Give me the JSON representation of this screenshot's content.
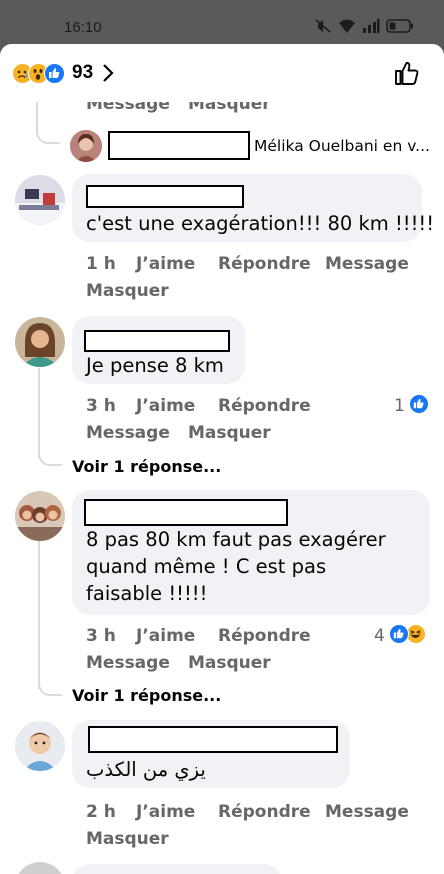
{
  "status_bar": {
    "time": "16:10"
  },
  "header": {
    "reaction_count": "93"
  },
  "partial_top": {
    "message": "Message",
    "hide": "Masquer"
  },
  "reply_preview": {
    "text": "Mélika Ouelbani en v..."
  },
  "comments": [
    {
      "text": "c'est une exagération!!! 80 km !!!!!",
      "time": "1 h",
      "like": "J’aime",
      "reply": "Répondre",
      "message": "Message",
      "hide": "Masquer"
    },
    {
      "text": "Je pense 8 km",
      "time": "3 h",
      "like": "J’aime",
      "reply": "Répondre",
      "message": "Message",
      "hide": "Masquer",
      "reaction_count": "1",
      "view_replies": "Voir 1 réponse..."
    },
    {
      "text_lines": [
        "8 pas 80 km faut pas exagérer",
        "quand même ! C est pas",
        "faisable !!!!!"
      ],
      "time": "3 h",
      "like": "J’aime",
      "reply": "Répondre",
      "message": "Message",
      "hide": "Masquer",
      "reaction_count": "4",
      "view_replies": "Voir 1 réponse..."
    },
    {
      "text": "يزي من الكذب",
      "time": "2 h",
      "like": "J’aime",
      "reply": "Répondre",
      "message": "Message",
      "hide": "Masquer"
    }
  ],
  "colors": {
    "accent": "#1877f2",
    "bubble": "#f0f2f5",
    "secondary_text": "#65676b"
  },
  "icons": [
    "wifi-icon",
    "signal-icon",
    "battery-icon",
    "mute-icon",
    "sad-reaction-icon",
    "wow-reaction-icon",
    "like-reaction-icon",
    "haha-reaction-icon",
    "chevron-right-icon",
    "like-outline-icon"
  ]
}
